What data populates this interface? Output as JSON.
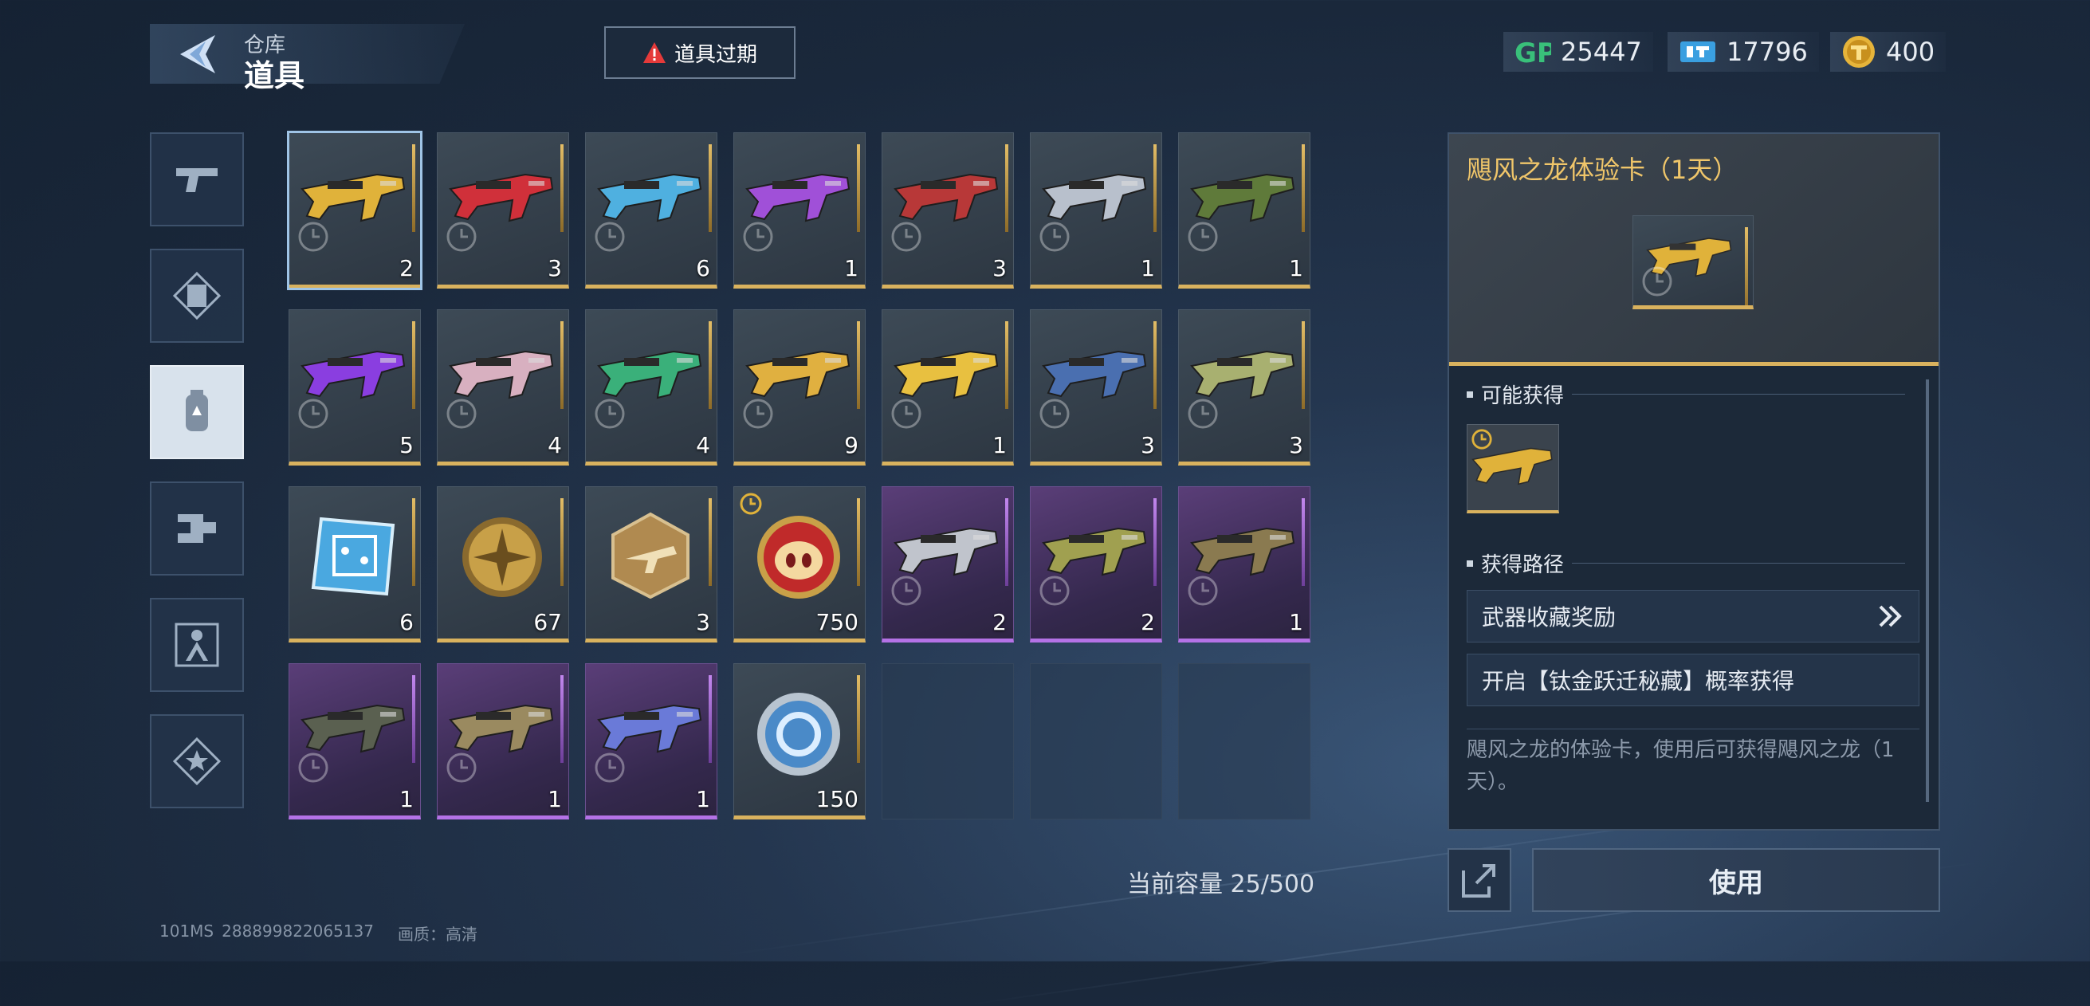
{
  "header": {
    "subtitle": "仓库",
    "title": "道具"
  },
  "expire_button": {
    "label": "道具过期"
  },
  "currencies": [
    {
      "icon": "gp-icon",
      "value": "25447"
    },
    {
      "icon": "ticket-icon",
      "value": "17796"
    },
    {
      "icon": "gold-coin-icon",
      "value": "400"
    }
  ],
  "categories": [
    {
      "name": "category-weapons",
      "icon": "pistol-icon",
      "active": false
    },
    {
      "name": "category-cards",
      "icon": "card-icon",
      "active": false
    },
    {
      "name": "category-items",
      "icon": "canister-icon",
      "active": true
    },
    {
      "name": "category-parts",
      "icon": "parts-icon",
      "active": false
    },
    {
      "name": "category-characters",
      "icon": "character-icon",
      "active": false
    },
    {
      "name": "category-badges",
      "icon": "star-badge-icon",
      "active": false
    }
  ],
  "items": [
    {
      "kind": "gun",
      "rarity": "gold",
      "count": "2",
      "color": "#e0b23a",
      "selected": true
    },
    {
      "kind": "gun",
      "rarity": "gold",
      "count": "3",
      "color": "#d0303a"
    },
    {
      "kind": "gun",
      "rarity": "gold",
      "count": "6",
      "color": "#4fb0e0"
    },
    {
      "kind": "gun",
      "rarity": "gold",
      "count": "1",
      "color": "#a050d8"
    },
    {
      "kind": "gun",
      "rarity": "gold",
      "count": "3",
      "color": "#b83838"
    },
    {
      "kind": "gun",
      "rarity": "gold",
      "count": "1",
      "color": "#b8c0cc"
    },
    {
      "kind": "gun",
      "rarity": "gold",
      "count": "1",
      "color": "#5f7a3a"
    },
    {
      "kind": "gun",
      "rarity": "gold",
      "count": "5",
      "color": "#8a3ee0"
    },
    {
      "kind": "gun",
      "rarity": "gold",
      "count": "4",
      "color": "#d8b0c0"
    },
    {
      "kind": "gun",
      "rarity": "gold",
      "count": "4",
      "color": "#3ab07a"
    },
    {
      "kind": "gun",
      "rarity": "gold",
      "count": "9",
      "color": "#e0b040"
    },
    {
      "kind": "gun",
      "rarity": "gold",
      "count": "1",
      "color": "#e8c040"
    },
    {
      "kind": "gun",
      "rarity": "gold",
      "count": "3",
      "color": "#4a6fb0"
    },
    {
      "kind": "gun",
      "rarity": "gold",
      "count": "3",
      "color": "#a8b070"
    },
    {
      "kind": "chip",
      "rarity": "gold",
      "count": "6",
      "color": "#4aa8e0"
    },
    {
      "kind": "cross-coin",
      "rarity": "gold",
      "count": "67",
      "color": "#c8a048"
    },
    {
      "kind": "hex-badge",
      "rarity": "gold",
      "count": "3",
      "color": "#b08a50"
    },
    {
      "kind": "pig-coin",
      "rarity": "gold",
      "count": "750",
      "color": "#c02a2a",
      "timer": true
    },
    {
      "kind": "gun",
      "rarity": "purple",
      "count": "2",
      "color": "#c0c4cc"
    },
    {
      "kind": "gun",
      "rarity": "purple",
      "count": "2",
      "color": "#a0a050"
    },
    {
      "kind": "gun",
      "rarity": "purple",
      "count": "1",
      "color": "#8a7a50"
    },
    {
      "kind": "gun",
      "rarity": "purple",
      "count": "1",
      "color": "#5a6050"
    },
    {
      "kind": "gun",
      "rarity": "purple",
      "count": "1",
      "color": "#9a8a60"
    },
    {
      "kind": "gun",
      "rarity": "purple",
      "count": "1",
      "color": "#6a7ad8"
    },
    {
      "kind": "ring-coin",
      "rarity": "gold",
      "count": "150",
      "color": "#4a8ac8"
    },
    {
      "kind": "empty"
    },
    {
      "kind": "empty"
    },
    {
      "kind": "empty"
    }
  ],
  "detail": {
    "title": "飓风之龙体验卡（1天）",
    "possible_section": "可能获得",
    "path_section": "获得路径",
    "paths": [
      "武器收藏奖励",
      "开启【钛金跃迁秘藏】概率获得"
    ],
    "description": "飓风之龙的体验卡，使用后可获得飓风之龙（1天）。",
    "accent": "#f0c66a"
  },
  "capacity": "当前容量 25/500",
  "use_button": "使用",
  "footer": {
    "ping": "101MS",
    "uid": "288899822065137",
    "quality": "画质：高清"
  }
}
